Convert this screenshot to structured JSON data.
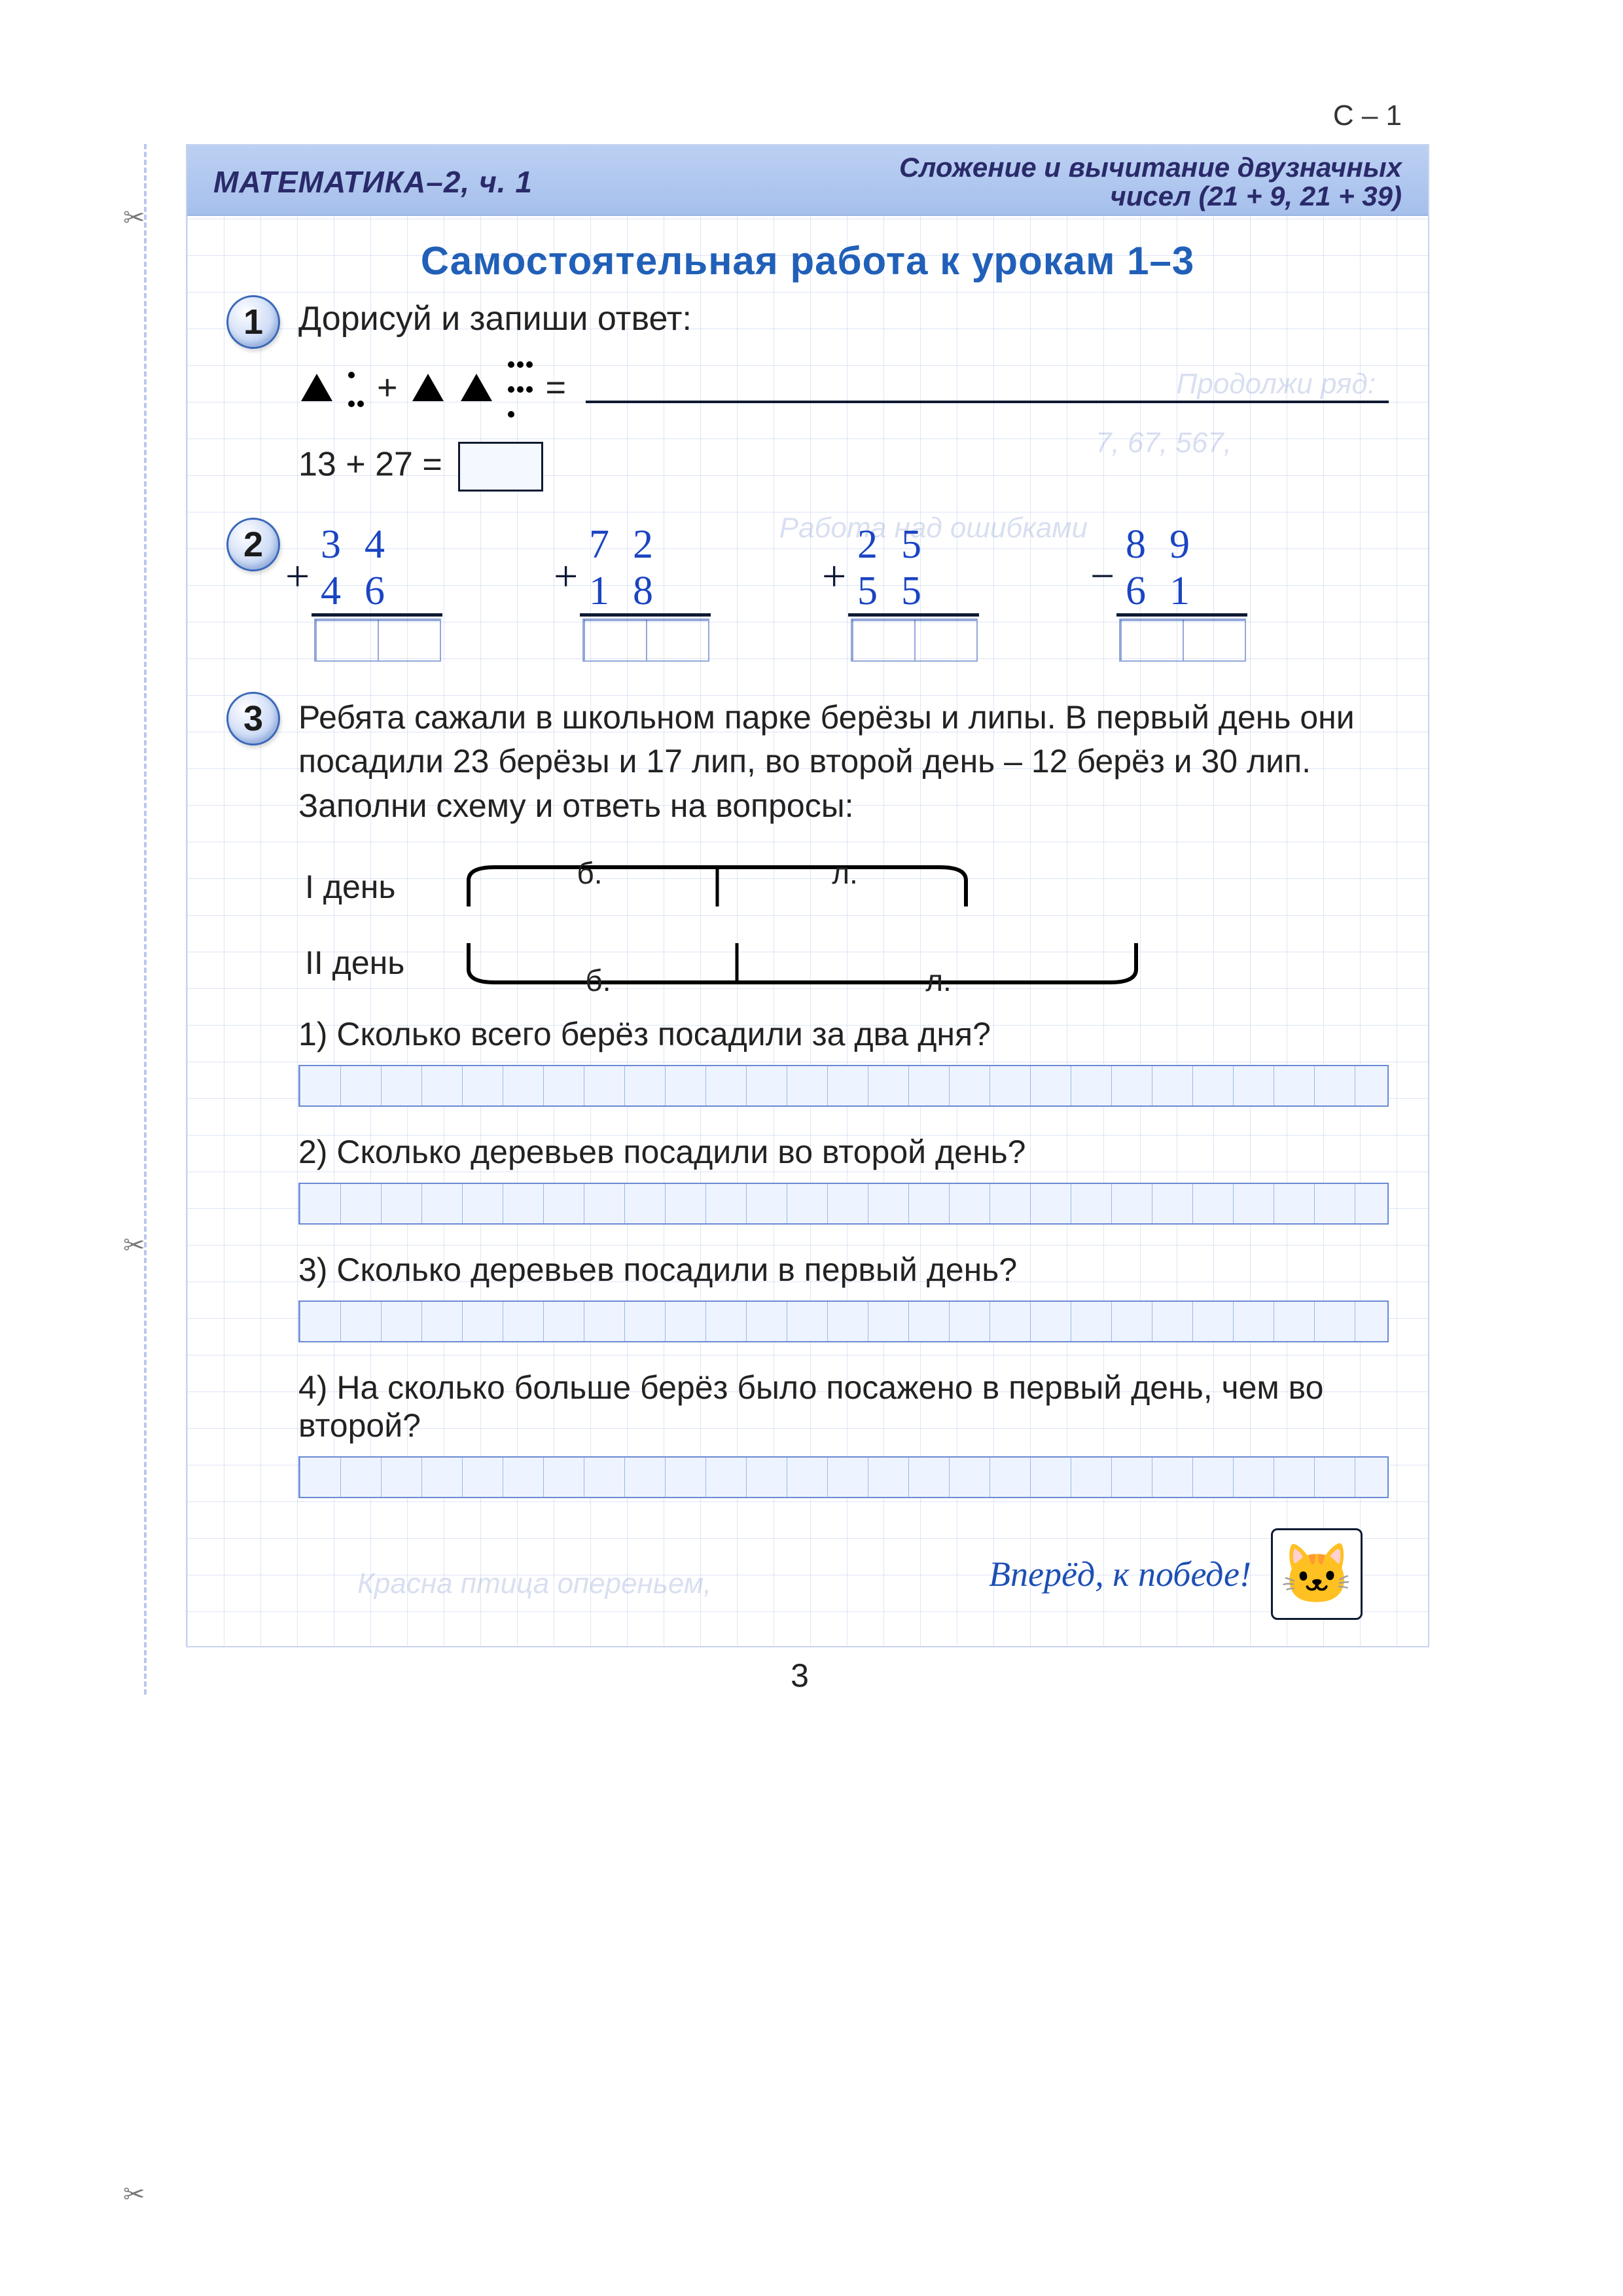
{
  "corner": "С – 1",
  "header": {
    "left": "МАТЕМАТИКА–2, ч. 1",
    "right_l1": "Сложение и вычитание двузначных",
    "right_l2": "чисел (21 + 9, 21 + 39)"
  },
  "title": "Самостоятельная работа к урокам 1–3",
  "task1": {
    "num": "1",
    "prompt": "Дорисуй и запиши ответ:",
    "eq_symbol": "=",
    "plus": "+",
    "equation": "13 + 27 ="
  },
  "task2": {
    "num": "2",
    "problems": [
      {
        "sign": "+",
        "a": "34",
        "b": "46"
      },
      {
        "sign": "+",
        "a": "72",
        "b": "18"
      },
      {
        "sign": "+",
        "a": "25",
        "b": "55"
      },
      {
        "sign": "−",
        "a": "89",
        "b": "61"
      }
    ]
  },
  "task3": {
    "num": "3",
    "text": "Ребята сажали в школьном парке берёзы и липы. В первый день они посадили 23 берёзы и 17 лип, во второй день – 12 берёз и 30 лип. Заполни схему и ответь на вопросы:",
    "day1_label": "I день",
    "day2_label": "II день",
    "b_label": "б.",
    "l_label": "л.",
    "q1": "1) Сколько всего берёз посадили за два дня?",
    "q2": "2) Сколько деревьев посадили во второй день?",
    "q3": "3) Сколько деревьев посадили в первый день?",
    "q4": "4) На сколько больше берёз было посажено в первый день, чем во второй?"
  },
  "ghost": {
    "g1": "Продолжи ряд:",
    "g2": "7, 67, 567,",
    "g3": "Работа над ошибками",
    "g4": "Красна птица опереньем,"
  },
  "footer": {
    "motto": "Вперёд, к победе!",
    "cat_glyph": "🐱",
    "page": "3"
  }
}
